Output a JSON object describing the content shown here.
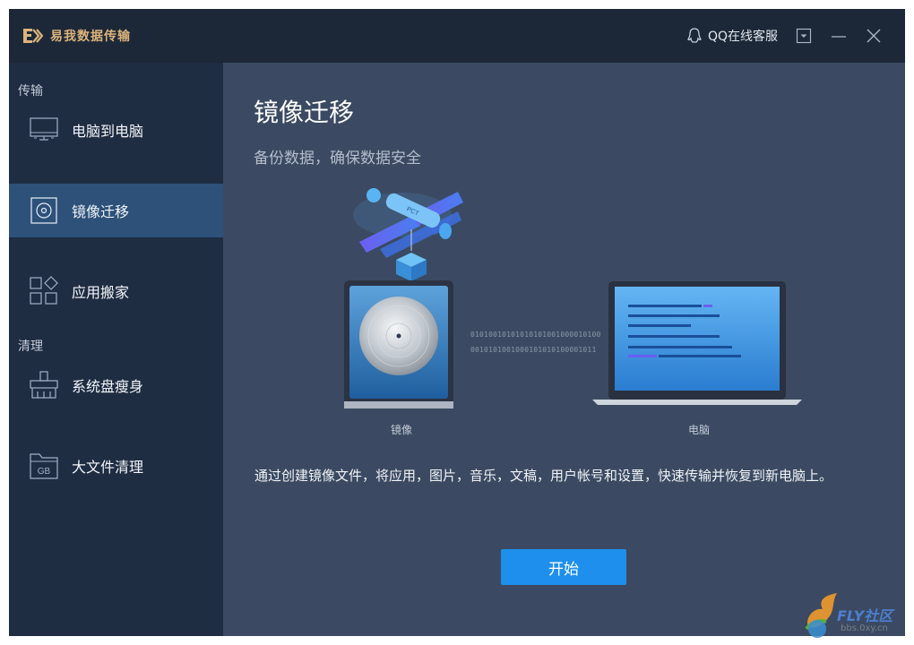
{
  "app": {
    "title": "易我数据传输"
  },
  "titlebar": {
    "support_label": "QQ在线客服"
  },
  "sidebar": {
    "section_transfer": "传输",
    "section_clean": "清理",
    "items": [
      {
        "label": "电脑到电脑",
        "icon": "monitor-icon",
        "active": false
      },
      {
        "label": "镜像迁移",
        "icon": "disc-icon",
        "active": true
      },
      {
        "label": "应用搬家",
        "icon": "apps-icon",
        "active": false
      },
      {
        "label": "系统盘瘦身",
        "icon": "brush-icon",
        "active": false
      },
      {
        "label": "大文件清理",
        "icon": "gb-folder-icon",
        "active": false
      }
    ]
  },
  "main": {
    "title": "镜像迁移",
    "subtitle": "备份数据，确保数据安全",
    "illustration": {
      "satellite_text": "PCT",
      "binary_line1": "01010010101010101001000010100",
      "binary_line2": "0010101001000101010100001011",
      "left_caption": "镜像",
      "right_caption": "电脑"
    },
    "description": "通过创建镜像文件，将应用，图片，音乐，文稿，用户帐号和设置，快速传输并恢复到新电脑上。",
    "start_button": "开始"
  },
  "watermark": {
    "brand": "FLY社区",
    "url": "bbs.0xy.cn"
  },
  "colors": {
    "titlebar_bg": "#1c2838",
    "sidebar_bg": "#1f2d42",
    "active_item_bg": "#2d5179",
    "main_bg": "#3b4a62",
    "accent": "#1e8fec",
    "logo_gold": "#dcb37a"
  }
}
